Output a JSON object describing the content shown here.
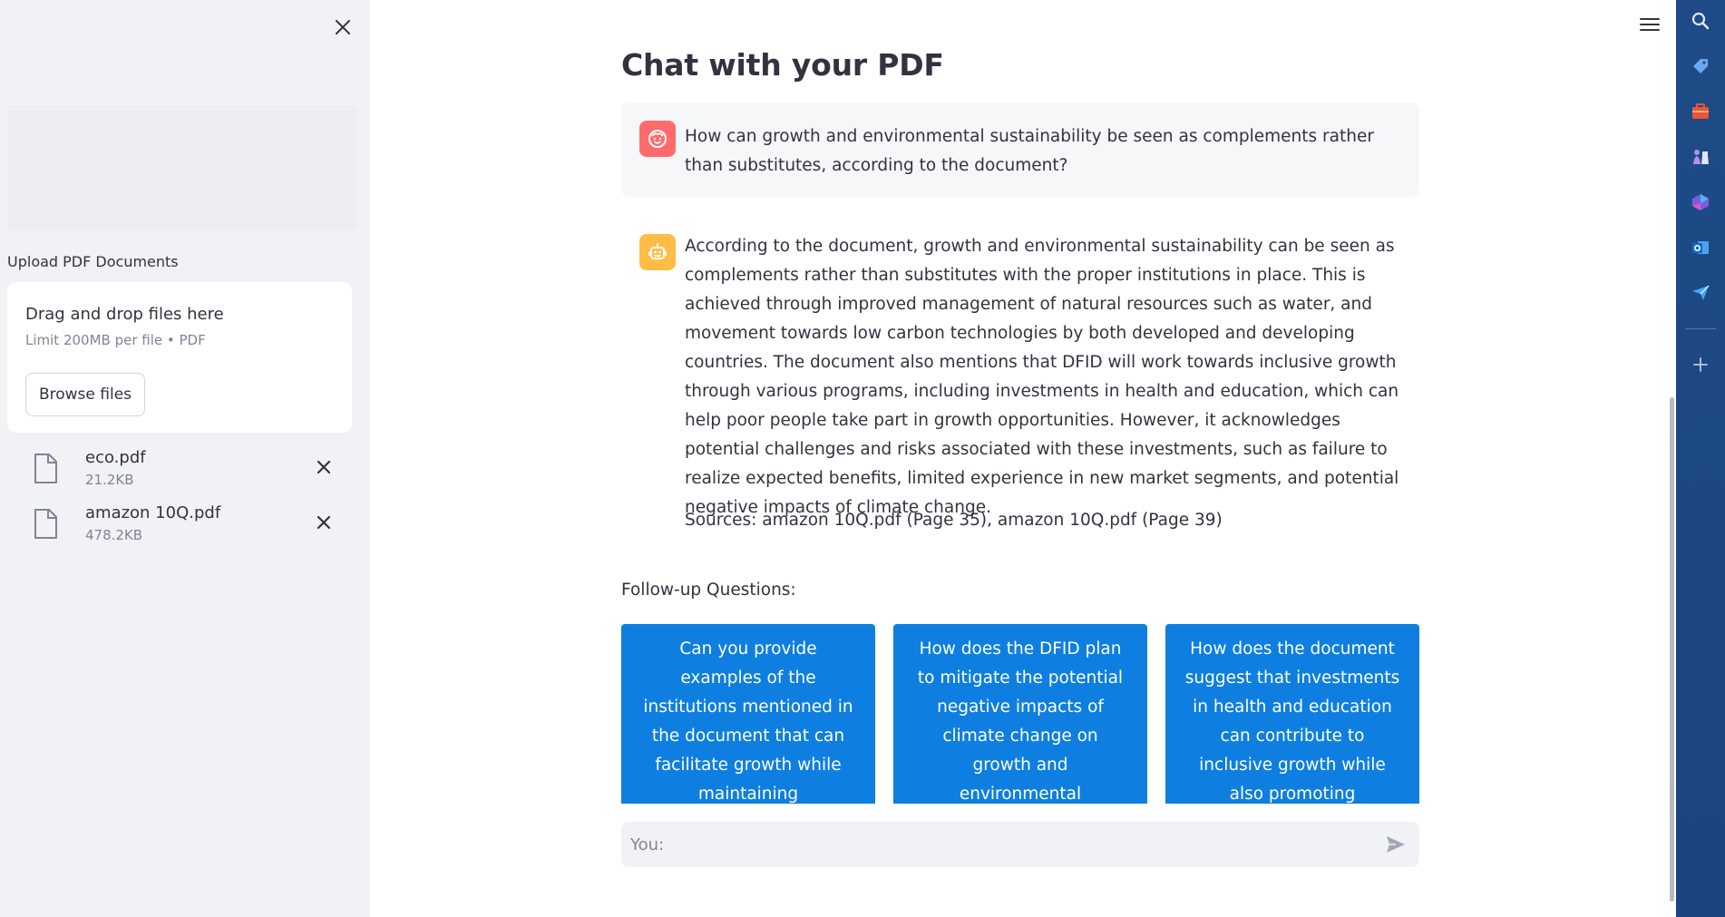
{
  "sidebar": {
    "upload_label": "Upload PDF Documents",
    "dropzone": {
      "title": "Drag and drop files here",
      "limit": "Limit 200MB per file • PDF",
      "browse_label": "Browse files"
    },
    "files": [
      {
        "name": "eco.pdf",
        "size": "21.2KB"
      },
      {
        "name": "amazon 10Q.pdf",
        "size": "478.2KB"
      }
    ]
  },
  "main": {
    "title": "Chat with your PDF",
    "messages": {
      "user": {
        "text": "How can growth and environmental sustainability be seen as complements rather than substitutes, according to the document?"
      },
      "assistant": {
        "text": "According to the document, growth and environmental sustainability can be seen as complements rather than substitutes with the proper institutions in place. This is achieved through improved management of natural resources such as water, and movement towards low carbon technologies by both developed and developing countries. The document also mentions that DFID will work towards inclusive growth through various programs, including investments in health and education, which can help poor people take part in growth opportunities. However, it acknowledges potential challenges and risks associated with these investments, such as failure to realize expected benefits, limited experience in new market segments, and potential negative impacts of climate change.",
        "sources": "Sources: amazon 10Q.pdf (Page 35), amazon 10Q.pdf (Page 39)"
      }
    },
    "followup_label": "Follow-up Questions:",
    "followups": [
      "Can you provide examples of the institutions mentioned in the document that can facilitate growth while maintaining environmental",
      "How does the DFID plan to mitigate the potential negative impacts of climate change on growth and environmental sustainability?",
      "How does the document suggest that investments in health and education can contribute to inclusive growth while also promoting environmental"
    ],
    "chat_input": {
      "placeholder": "You:",
      "value": ""
    }
  },
  "colors": {
    "sidebar_bg": "#f0f2f6",
    "user_avatar": "#ff6b6b",
    "bot_avatar": "#ffbd45",
    "followup_button": "#0e7fe0",
    "edge_bar": "#1e4b87"
  },
  "icons": {
    "sidebar_close": "close-icon",
    "file": "file-icon",
    "file_remove": "close-icon",
    "menu": "hamburger-menu-icon",
    "send": "send-icon",
    "edge_bar": [
      "search-icon",
      "tag-icon",
      "briefcase-icon",
      "chess-icon",
      "copilot-icon",
      "outlook-icon",
      "send-icon",
      "add-icon"
    ]
  }
}
